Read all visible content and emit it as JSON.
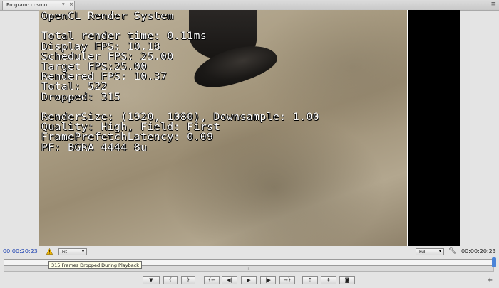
{
  "tab": {
    "label": "Program: cosmo",
    "dropdown_glyph": "▾",
    "close_glyph": "×"
  },
  "panel_menu_glyph": "≡",
  "overlay": {
    "lines": [
      "OpenCL Render System",
      "",
      "Total render time: 0.11ms",
      "Display FPS: 10.18",
      "Scheduler FPS: 25.00",
      "Target FPS:25.00",
      "Rendered FPS: 10.37",
      "Total: 522",
      "Dropped: 315",
      "",
      "RenderSize: (1920, 1080), Downsample: 1.00",
      "Quality: High, Field: First",
      "FramePrefetchLatency: 0.09",
      "PF: BGRA 4444 8u"
    ]
  },
  "timecode": {
    "current": "00:00:20:23",
    "duration": "00:00:20:23"
  },
  "zoom_select": {
    "value": "Fit"
  },
  "resolution_select": {
    "value": "Full"
  },
  "tooltip": "315 Frames Dropped During Playback",
  "transport": [
    {
      "name": "add-marker-button",
      "glyph": "▼"
    },
    {
      "name": "mark-in-button",
      "glyph": "{"
    },
    {
      "name": "mark-out-button",
      "glyph": "}"
    },
    {
      "name": "go-to-in-button",
      "glyph": "{←"
    },
    {
      "name": "step-back-button",
      "glyph": "◀|"
    },
    {
      "name": "play-button",
      "glyph": "▶"
    },
    {
      "name": "step-forward-button",
      "glyph": "|▶"
    },
    {
      "name": "go-to-out-button",
      "glyph": "→}"
    },
    {
      "name": "lift-button",
      "glyph": "⇡"
    },
    {
      "name": "extract-button",
      "glyph": "⇞"
    },
    {
      "name": "export-frame-button",
      "glyph": "◙"
    }
  ],
  "add_button_glyph": "+",
  "colors": {
    "timecode_accent": "#1a3fb0",
    "warning": "#f2b705",
    "playhead": "#4a84d8"
  }
}
